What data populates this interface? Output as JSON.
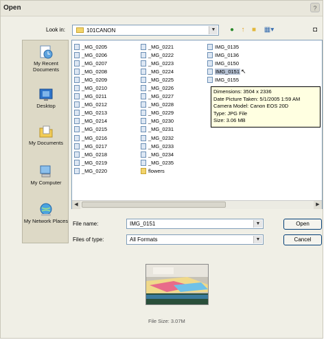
{
  "window": {
    "title": "Open",
    "help_icon": "?"
  },
  "toolbar": {
    "lookin_label": "Look in:",
    "lookin_value": "101CANON",
    "icons": [
      "back-arrow-icon",
      "up-folder-icon",
      "new-folder-icon",
      "views-menu-icon",
      "camera-icon"
    ]
  },
  "places": [
    {
      "label": "My Recent Documents",
      "icon": "recent-documents-icon"
    },
    {
      "label": "Desktop",
      "icon": "desktop-icon"
    },
    {
      "label": "My Documents",
      "icon": "my-documents-icon"
    },
    {
      "label": "My Computer",
      "icon": "my-computer-icon"
    },
    {
      "label": "My Network Places",
      "icon": "network-places-icon"
    }
  ],
  "files": {
    "col1": [
      "_MG_0205",
      "_MG_0206",
      "_MG_0207",
      "_MG_0208",
      "_MG_0209",
      "_MG_0210",
      "_MG_0211",
      "_MG_0212",
      "_MG_0213",
      "_MG_0214",
      "_MG_0215",
      "_MG_0216",
      "_MG_0217",
      "_MG_0218",
      "_MG_0219",
      "_MG_0220"
    ],
    "col2": [
      "_MG_0221",
      "_MG_0222",
      "_MG_0223",
      "_MG_0224",
      "_MG_0225",
      "_MG_0226",
      "_MG_0227",
      "_MG_0228",
      "_MG_0229",
      "_MG_0230",
      "_MG_0231",
      "_MG_0232",
      "_MG_0233",
      "_MG_0234",
      "_MG_0235",
      "flowers"
    ],
    "col3": [
      "IMG_0135",
      "IMG_0136",
      "IMG_0150",
      "IMG_0151",
      "IMG_0155"
    ],
    "selected": "IMG_0151"
  },
  "tooltip": {
    "dimensions": "Dimensions: 3504 x 2336",
    "date": "Date Picture Taken: 5/1/2005 1:59 AM",
    "camera": "Camera Model: Canon EOS 20D",
    "type": "Type: JPG File",
    "size": "Size: 3.06 MB"
  },
  "form": {
    "filename_label": "File name:",
    "filename_value": "IMG_0151",
    "filetype_label": "Files of type:",
    "filetype_value": "All Formats",
    "open_label": "Open",
    "cancel_label": "Cancel"
  },
  "preview": {
    "file_size": "File Size: 3.07M"
  },
  "colors": {
    "dialog_bg": "#f0efe6",
    "places_bg": "#ddd9c6",
    "tooltip_bg": "#ffffe1",
    "combo_border": "#7f9db9"
  }
}
